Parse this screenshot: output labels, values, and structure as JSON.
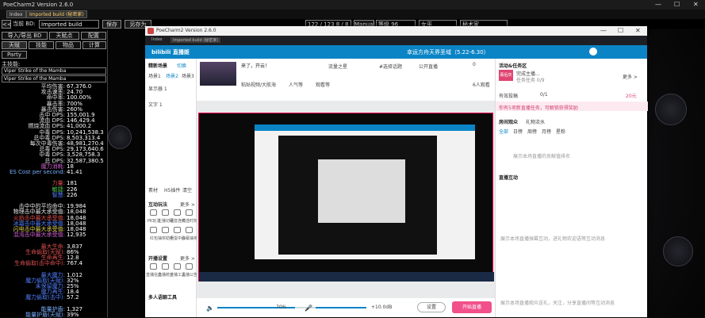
{
  "pob": {
    "title": "PoeCharm2 Version 2.6.0",
    "tabs": [
      "Index",
      "Imported build (秘密家)"
    ],
    "bar": {
      "back_label": "<<",
      "back_value": "当前 BD:",
      "build_name": "Imported build",
      "save_label": "保存",
      "save_as_label": "另存为",
      "points": "122 / 123  8 / 8",
      "manual_label": "Manual",
      "level": "等级 96",
      "class_label": "女巫",
      "ascend_label": "秘术家"
    },
    "left_buttons": [
      "导入/导出 BD",
      "天赋点",
      "配置",
      "天赋",
      "技能",
      "物品",
      "计算",
      "Party"
    ],
    "main_skill_label": "主技能:",
    "skill_selects": [
      "Viper Strike of the Mamba",
      "Viper Strike of the Mamba"
    ],
    "stats": [
      {
        "k": "平均伤害:",
        "v": "67,376.0",
        "c": "#e4e4e4"
      },
      {
        "k": "攻击速率:",
        "v": "24.70",
        "c": "#e4e4e4"
      },
      {
        "k": "命中率:",
        "v": "100.00%",
        "c": "#e4e4e4"
      },
      {
        "k": "暴击率:",
        "v": "700%",
        "c": "#e4e4e4"
      },
      {
        "k": "暴击伤害:",
        "v": "260%",
        "c": "#e4e4e4"
      },
      {
        "k": "击中 DPS:",
        "v": "155,001.9",
        "c": "#e4e4e4"
      },
      {
        "k": "流血 DPS:",
        "v": "146,429.4",
        "c": "#e4e4e4"
      },
      {
        "k": "燃烧流血 DPS:",
        "v": "41,000.2",
        "c": "#e4e4e4"
      },
      {
        "k": "中毒 DPS:",
        "v": "10,241,538.3",
        "c": "#e4e4e4"
      },
      {
        "k": "总中毒 DPS:",
        "v": "8,503,313.4",
        "c": "#e4e4e4"
      },
      {
        "k": "每次中毒伤害:",
        "v": "48,981,270.4",
        "c": "#e4e4e4"
      },
      {
        "k": "总毒 DPS:",
        "v": "29,173,640.6",
        "c": "#e4e4e4"
      },
      {
        "k": "中毒 DPS:",
        "v": "3,528,758.3",
        "c": "#e4e4e4"
      },
      {
        "k": "总 DPS:",
        "v": "32,587,380.5",
        "c": "#e4e4e4"
      },
      {
        "k": "魔力消耗:",
        "v": "18",
        "c": "#d060d0"
      },
      {
        "k": "ES Cost per second:",
        "v": "41.41",
        "c": "#7ab0ff"
      },
      {
        "k": "",
        "v": "",
        "c": "#000"
      },
      {
        "k": "力量:",
        "v": "181",
        "c": "#e05050"
      },
      {
        "k": "敏捷:",
        "v": "226",
        "c": "#50c050"
      },
      {
        "k": "智慧:",
        "v": "226",
        "c": "#5080ff"
      },
      {
        "k": "",
        "v": "",
        "c": "#000"
      },
      {
        "k": "击中中的平均命中:",
        "v": "19,984",
        "c": "#e4e4e4"
      },
      {
        "k": "物理击中最大承受值:",
        "v": "18,048",
        "c": "#e4e4e4"
      },
      {
        "k": "火焰击中最大承受值:",
        "v": "18,048",
        "c": "#e05050"
      },
      {
        "k": "冰霜击中最大承受值:",
        "v": "18,048",
        "c": "#5080ff"
      },
      {
        "k": "闪电击中最大承受值:",
        "v": "18,048",
        "c": "#e0d050"
      },
      {
        "k": "混沌击中最大承受值:",
        "v": "12,935",
        "c": "#d060d0"
      },
      {
        "k": "",
        "v": "",
        "c": "#000"
      },
      {
        "k": "最大生命:",
        "v": "3,837",
        "c": "#e05050"
      },
      {
        "k": "生命偷取(天赋):",
        "v": "86%",
        "c": "#e05050"
      },
      {
        "k": "生命再生:",
        "v": "12.8",
        "c": "#e05050"
      },
      {
        "k": "生命偷取(击中命中):",
        "v": "767.4",
        "c": "#e05050"
      },
      {
        "k": "",
        "v": "",
        "c": "#000"
      },
      {
        "k": "最大魔力:",
        "v": "1,012",
        "c": "#5080ff"
      },
      {
        "k": "魔力偷取(天赋):",
        "v": "32%",
        "c": "#5080ff"
      },
      {
        "k": "未保留魔力:",
        "v": "25%",
        "c": "#5080ff"
      },
      {
        "k": "魔力再生:",
        "v": "18.4",
        "c": "#5080ff"
      },
      {
        "k": "魔力偷取(击中):",
        "v": "57.2",
        "c": "#5080ff"
      },
      {
        "k": "",
        "v": "",
        "c": "#000"
      },
      {
        "k": "能量护盾:",
        "v": "1,327",
        "c": "#7ab0ff"
      },
      {
        "k": "能量护盾(天赋):",
        "v": "39%",
        "c": "#7ab0ff"
      }
    ],
    "win_controls": [
      "—",
      "☐",
      "✕"
    ]
  },
  "app": {
    "title": "PoeCharm2 Version 2.6.0",
    "tabs": [
      "Index",
      "Imported build (秘密家)"
    ],
    "brand": "bilibili 直播姬",
    "live_title": "幸运方舟天界圣域（5.22-6.30）",
    "left": {
      "scene_header": "精新场景",
      "switch_label": "切换",
      "scene_tabs": [
        "场景1",
        "场景2",
        "场景3"
      ],
      "sources": [
        "显示器 1",
        "文字 1"
      ],
      "tools": [
        "素材",
        "H5插件",
        "清空"
      ],
      "interact_title": "互动玩法",
      "more1": "更多 >",
      "interact_icons": [
        "PK玩法",
        "主播切磋",
        "语音连线",
        "天选时刻",
        "红包",
        "抽奖助手",
        "扭蛋中心",
        "弹幕抽奖"
      ],
      "stream_title": "开播设置",
      "more2": "更多 >",
      "stream_icons": [
        "直播信息",
        "直播统计",
        "主播工具",
        "主播公告"
      ],
      "multi_label": "多人语聊工具"
    },
    "center": {
      "info_title": "来了，开云！",
      "flow_label": "流量之星",
      "tag_label": "#选择话题",
      "announce_label": "公开直播",
      "room_tag1": "粘贴视频/大航海",
      "room_tag2": "人气等",
      "room_tag3": "观看等",
      "count1": "0",
      "count2": "6人观看",
      "vol_pct": "70%",
      "mic_db": "+10.0dB",
      "settings_label": "设置",
      "start_label": "开始直播"
    },
    "right": {
      "activity_title": "活动&任务区",
      "badge": "幕后庆会",
      "task_text": "完成主播...",
      "task_sub": "任务任务 0/9",
      "more3": "更多 >",
      "reward_label": "有效投稿",
      "reward_prog": "0/1",
      "reward_val": "20元",
      "notice": "你有5项新直播任务，可解锁获得奖励",
      "chat_title": "房间观众",
      "chat_tabs": [
        "房间观众",
        "礼物流水"
      ],
      "chat_subtabs": [
        "全部",
        "日榜",
        "周榜",
        "月榜",
        "星粉"
      ],
      "empty_msg": "展示本场直播的贡献值排名",
      "interact_title": "直播互动",
      "interact_empty": "展示本场直播弹幕互动，进礼物欢迎语等互动消息",
      "bottom_text": "展示本场直播观众送礼，关注，分享直播间等互动消息"
    },
    "win_controls": [
      "—",
      "☐",
      "✕"
    ]
  }
}
